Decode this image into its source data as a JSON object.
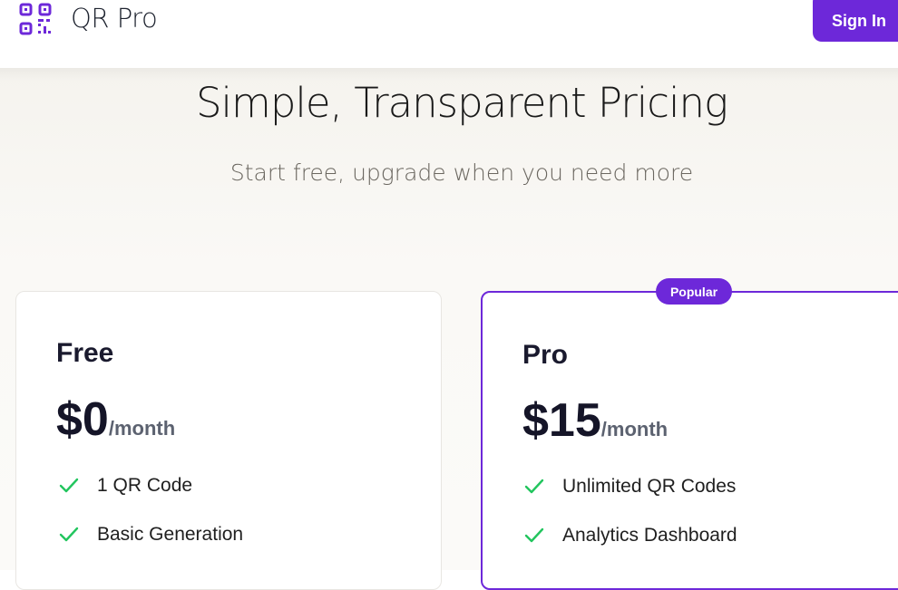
{
  "header": {
    "brand": "QR Pro",
    "logo_icon": "qr-code-icon",
    "sign_in_label": "Sign In"
  },
  "hero": {
    "title": "Simple, Transparent Pricing",
    "subtitle": "Start free, upgrade when you need more"
  },
  "plans": [
    {
      "name": "Free",
      "price": "$0",
      "period": "/month",
      "features": [
        "1 QR Code",
        "Basic Generation"
      ]
    },
    {
      "name": "Pro",
      "badge": "Popular",
      "price": "$15",
      "period": "/month",
      "features": [
        "Unlimited QR Codes",
        "Analytics Dashboard"
      ]
    }
  ],
  "colors": {
    "accent": "#6d28d9",
    "check": "#22c55e",
    "text_dark": "#151528"
  },
  "icons": {
    "feature_icon": "check-icon"
  }
}
